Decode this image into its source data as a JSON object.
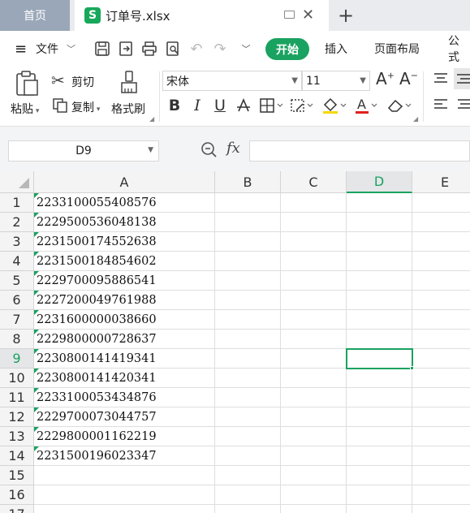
{
  "tabs": {
    "home": "首页",
    "file": "订单号.xlsx",
    "new_tab": "+"
  },
  "menu": {
    "hamburger": "≡",
    "file": "文件",
    "items": [
      "开始",
      "插入",
      "页面布局",
      "公式"
    ]
  },
  "ribbon": {
    "paste": "粘贴",
    "cut": "剪切",
    "copy": "复制",
    "format_painter": "格式刷",
    "font_name": "宋体",
    "font_size": "11",
    "bold": "B",
    "italic": "I",
    "underline": "U",
    "font_color_letter": "A"
  },
  "formula_bar": {
    "name_box": "D9",
    "fx": "fx",
    "formula": ""
  },
  "sheet": {
    "columns": [
      "A",
      "B",
      "C",
      "D",
      "E"
    ],
    "active_column": "D",
    "active_row": 9,
    "rows": [
      {
        "n": "1",
        "a": "2233100055408576"
      },
      {
        "n": "2",
        "a": "2229500536048138"
      },
      {
        "n": "3",
        "a": "2231500174552638"
      },
      {
        "n": "4",
        "a": "2231500184854602"
      },
      {
        "n": "5",
        "a": "2229700095886541"
      },
      {
        "n": "6",
        "a": "2227200049761988"
      },
      {
        "n": "7",
        "a": "2231600000038660"
      },
      {
        "n": "8",
        "a": "2229800000728637"
      },
      {
        "n": "9",
        "a": "2230800141419341"
      },
      {
        "n": "10",
        "a": "2230800141420341"
      },
      {
        "n": "11",
        "a": "2233100053434876"
      },
      {
        "n": "12",
        "a": "2229700073044757"
      },
      {
        "n": "13",
        "a": "2229800001162219"
      },
      {
        "n": "14",
        "a": "2231500196023347"
      },
      {
        "n": "15",
        "a": ""
      },
      {
        "n": "16",
        "a": ""
      },
      {
        "n": "17",
        "a": ""
      }
    ]
  },
  "colors": {
    "accent": "#1aa260",
    "home_tab": "#9aa7b8"
  }
}
